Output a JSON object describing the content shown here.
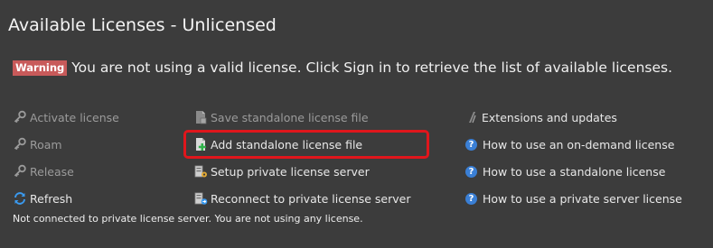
{
  "title": "Available Licenses - Unlicensed",
  "warning": {
    "badge": "Warning",
    "message": "You are not using a valid license. Click Sign in to retrieve the list of available licenses."
  },
  "actions_left": [
    {
      "label": "Activate license",
      "icon": "key-icon",
      "enabled": false
    },
    {
      "label": "Roam",
      "icon": "key-icon",
      "enabled": false
    },
    {
      "label": "Release",
      "icon": "key-icon",
      "enabled": false
    },
    {
      "label": "Refresh",
      "icon": "refresh-icon",
      "enabled": true
    }
  ],
  "actions_middle": [
    {
      "label": "Save standalone license file",
      "icon": "save-file-icon",
      "enabled": false
    },
    {
      "label": "Add standalone license file",
      "icon": "add-file-icon",
      "enabled": true
    },
    {
      "label": "Setup private license server",
      "icon": "server-icon",
      "enabled": true
    },
    {
      "label": "Reconnect to private license server",
      "icon": "server-connect-icon",
      "enabled": true
    }
  ],
  "actions_right": [
    {
      "label": "Extensions and updates",
      "icon": "extensions-icon"
    },
    {
      "label": "How to use an on-demand license",
      "icon": "help-icon"
    },
    {
      "label": "How to use a standalone license",
      "icon": "help-icon"
    },
    {
      "label": "How to use a private server license",
      "icon": "help-icon"
    }
  ],
  "status": "Not connected to private license server. You are not using any license.",
  "colors": {
    "background": "#3c3c3c",
    "warning_badge": "#c85a5a",
    "highlight_outline": "#e0161c",
    "help_icon": "#3a7fd5"
  }
}
